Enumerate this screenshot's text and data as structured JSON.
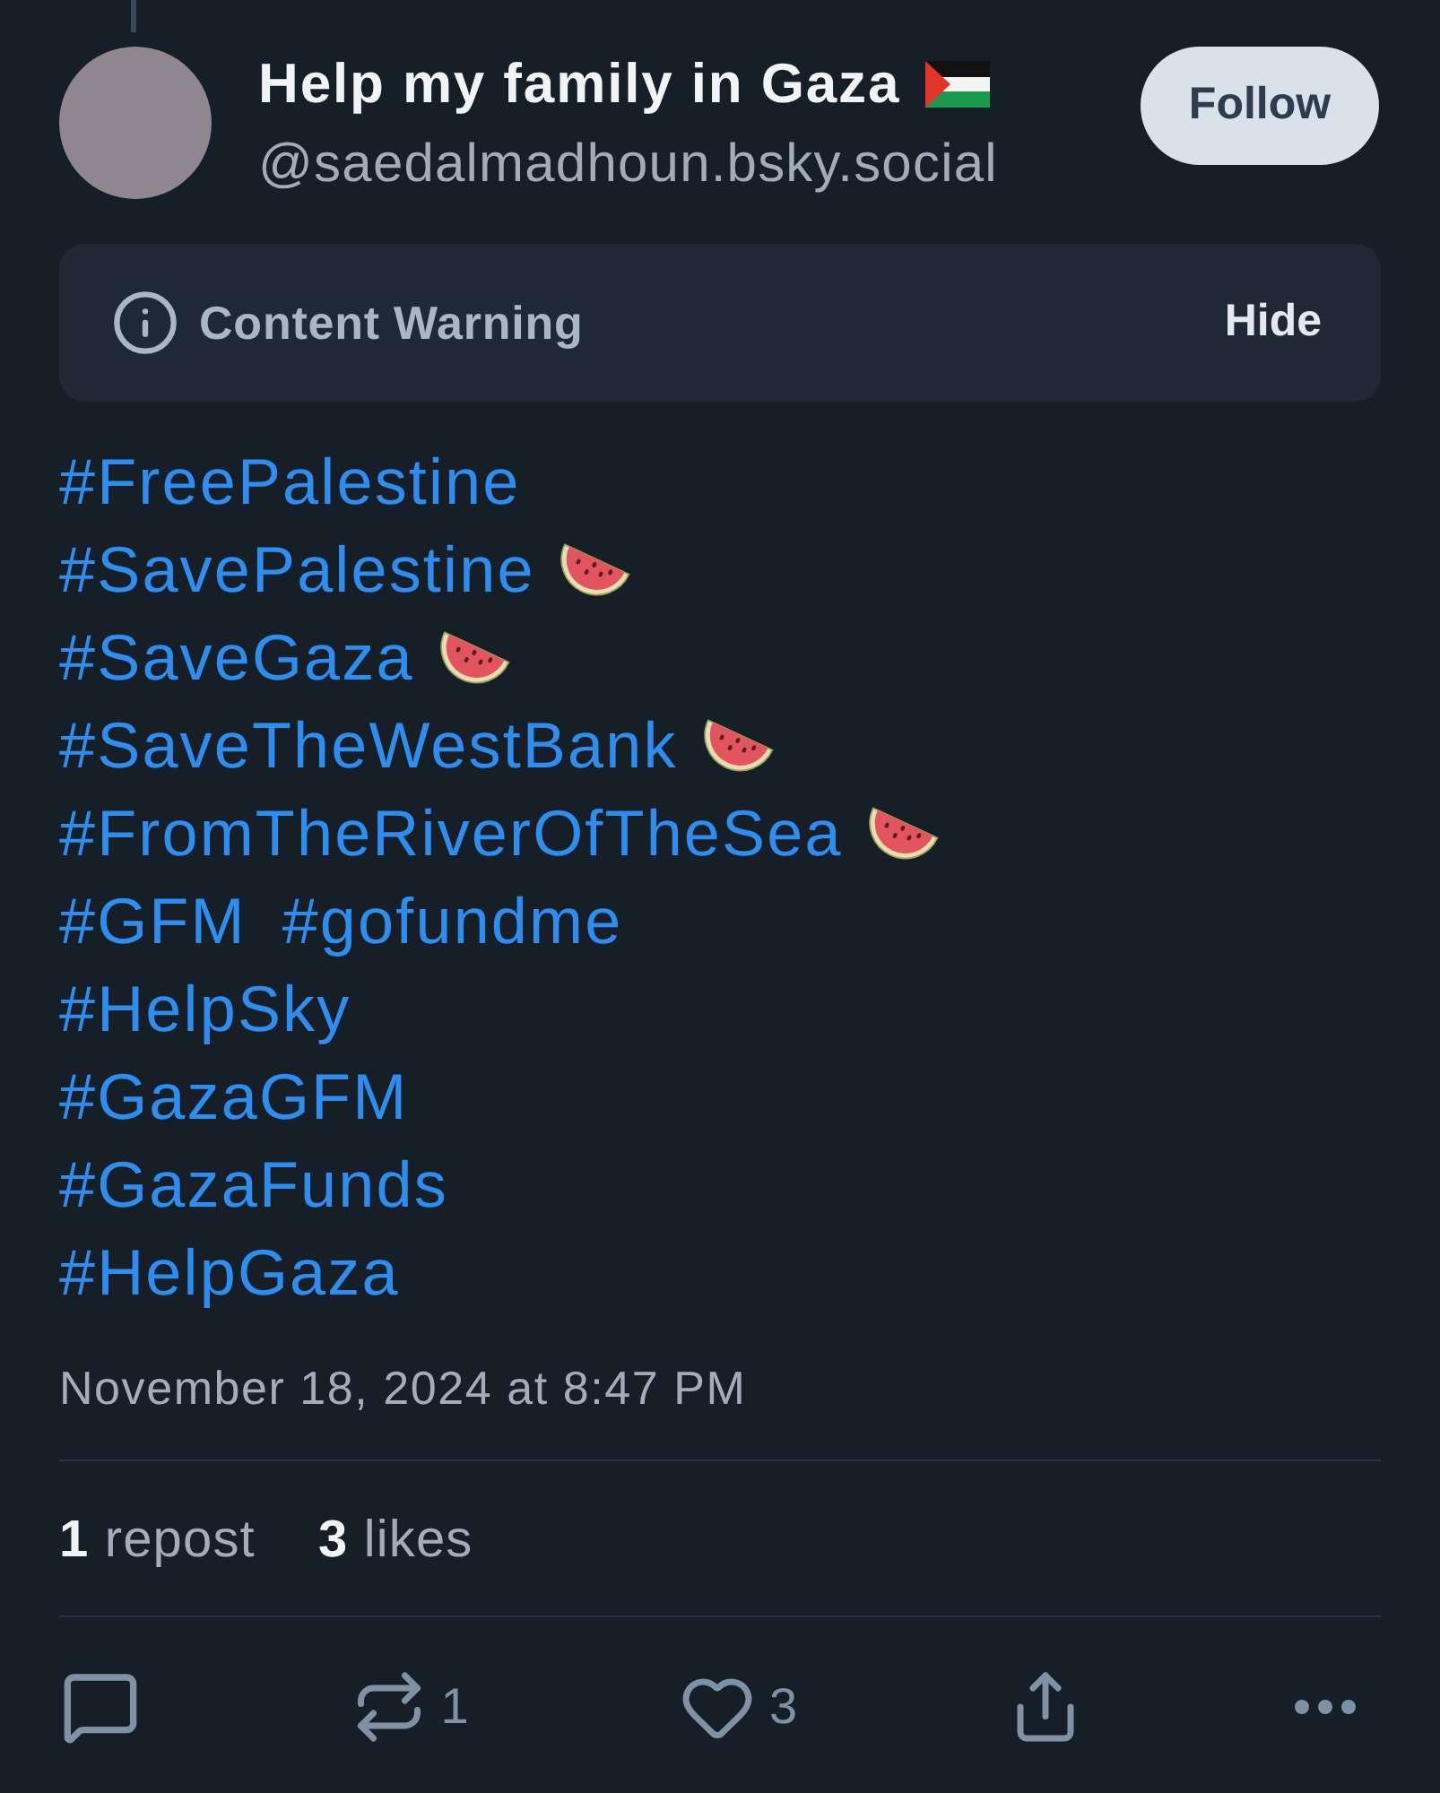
{
  "author": {
    "name": "Help my family in Gaza",
    "handle": "@saedalmadhoun.bsky.social"
  },
  "follow_button": {
    "label": "Follow"
  },
  "content_warning": {
    "label": "Content Warning",
    "action": "Hide"
  },
  "post": {
    "lines": [
      {
        "tags": [
          "#FreePalestine"
        ],
        "watermelon": false
      },
      {
        "tags": [
          "#SavePalestine"
        ],
        "watermelon": true
      },
      {
        "tags": [
          "#SaveGaza"
        ],
        "watermelon": true
      },
      {
        "tags": [
          "#SaveTheWestBank"
        ],
        "watermelon": true
      },
      {
        "tags": [
          "#FromTheRiverOfTheSea"
        ],
        "watermelon": true
      },
      {
        "tags": [
          "#GFM",
          "#gofundme"
        ],
        "watermelon": false
      },
      {
        "tags": [
          "#HelpSky"
        ],
        "watermelon": false
      },
      {
        "tags": [
          "#GazaGFM"
        ],
        "watermelon": false
      },
      {
        "tags": [
          "#GazaFunds"
        ],
        "watermelon": false
      },
      {
        "tags": [
          "#HelpGaza"
        ],
        "watermelon": false
      }
    ],
    "timestamp": "November 18, 2024 at 8:47 PM"
  },
  "stats": [
    {
      "count": "1",
      "label": "repost"
    },
    {
      "count": "3",
      "label": "likes"
    }
  ],
  "actions": [
    {
      "kind": "reply"
    },
    {
      "kind": "repost",
      "count": "1"
    },
    {
      "kind": "like",
      "count": "3"
    },
    {
      "kind": "share"
    },
    {
      "kind": "more"
    }
  ]
}
